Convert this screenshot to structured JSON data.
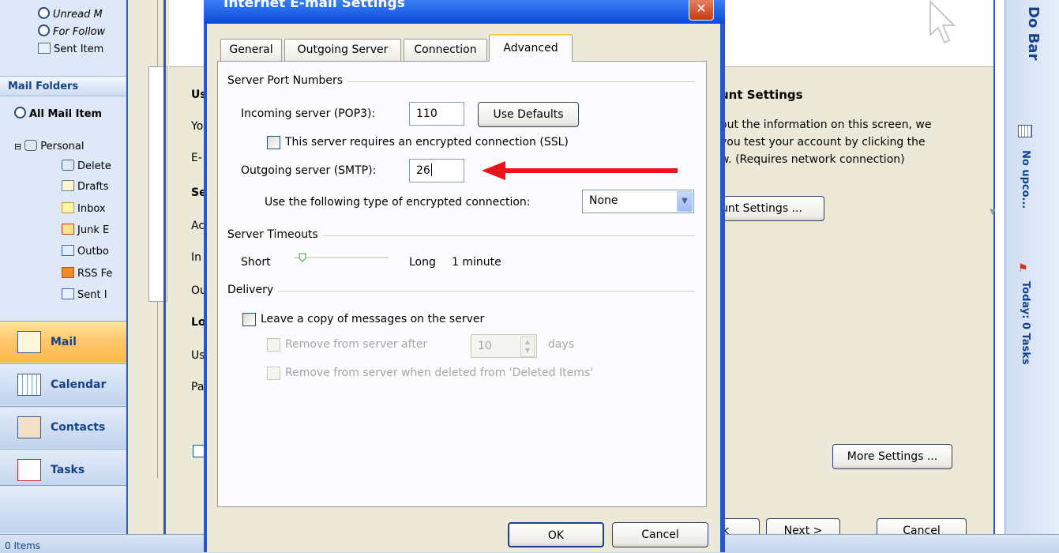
{
  "nav": {
    "top_items": [
      "Unread M",
      "For Follow",
      "Sent Item"
    ],
    "mail_folders_label": "Mail Folders",
    "all_mail_items": "All Mail Item",
    "personal": "Personal",
    "folders": [
      "Delete",
      "Drafts",
      "Inbox",
      "Junk E",
      "Outbo",
      "RSS Fe",
      "Sent I"
    ],
    "buttons": [
      "Mail",
      "Calendar",
      "Contacts",
      "Tasks"
    ],
    "status_text": "0 Items"
  },
  "wizard": {
    "left_letters": [
      "Us",
      "Yo",
      "E-",
      "Se",
      "Ac",
      "In",
      "Ou",
      "Lo",
      "Us",
      "Pa"
    ],
    "test_heading": "unt Settings",
    "test_text_lines": [
      "out the information on this screen, we",
      "you test your account by clicking the",
      "w. (Requires network connection)"
    ],
    "test_button": "unt Settings ...",
    "more_settings_button": "More Settings ...",
    "back_button": "k",
    "next_button": "Next >",
    "cancel_button": "Cancel"
  },
  "todo_bar": {
    "title": "Do Bar",
    "appointments": "No upco...",
    "tasks": "Today: 0 Tasks"
  },
  "dialog": {
    "title": "Internet E-mail Settings",
    "tabs": [
      "General",
      "Outgoing Server",
      "Connection",
      "Advanced"
    ],
    "active_tab": "Advanced",
    "port_group": "Server Port Numbers",
    "incoming_label": "Incoming server (POP3):",
    "incoming_value": "110",
    "use_defaults_button": "Use Defaults",
    "ssl_label": "This server requires an encrypted connection (SSL)",
    "outgoing_label": "Outgoing server (SMTP):",
    "outgoing_value": "26",
    "encryption_label": "Use the following type of encrypted connection:",
    "encryption_value": "None",
    "timeouts_group": "Server Timeouts",
    "short_label": "Short",
    "long_label": "Long",
    "timeout_value": "1 minute",
    "delivery_group": "Delivery",
    "leave_copy_label": "Leave a copy of messages on the server",
    "remove_after_label": "Remove from server after",
    "remove_days_value": "10",
    "days_label": "days",
    "remove_deleted_label": "Remove from server when deleted from 'Deleted Items'",
    "ok_button": "OK",
    "cancel_button": "Cancel"
  },
  "colors": {
    "annotation_arrow": "#e8141b",
    "xp_titlebar": "#0a4bd9",
    "active_tab_highlight": "#ffc83c"
  }
}
